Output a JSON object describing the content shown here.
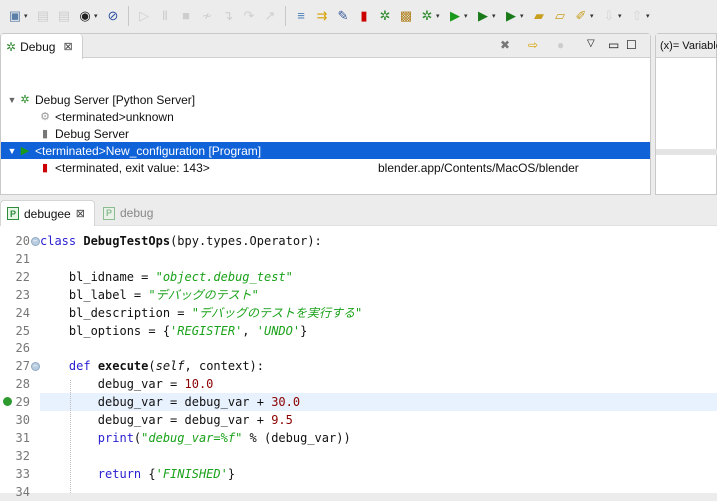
{
  "toolbar": {
    "icons": [
      "new-icon",
      "save-icon",
      "save-all-icon",
      "perspective-icon",
      "skip-breakpoints-icon",
      "resume-icon",
      "suspend-icon",
      "terminate-icon",
      "disconnect-icon",
      "step-into-icon",
      "step-over-icon",
      "step-return-icon",
      "drop-to-frame-icon",
      "use-step-filters-icon",
      "pydev-console-icon",
      "pydev-start-server-icon",
      "pydev-stop-server-icon",
      "pydev-open-icon",
      "debug-icon",
      "run-icon",
      "coverage-icon",
      "external-tools-icon",
      "open-type-icon",
      "open-folder-icon",
      "search-icon",
      "next-annotation-icon",
      "previous-annotation-icon"
    ]
  },
  "debug_view": {
    "tab_label": "Debug",
    "tree": [
      {
        "label": "Debug Server [Python Server]",
        "icon": "python-server-icon",
        "indent": 0,
        "expanded": true
      },
      {
        "label": "<terminated>unknown",
        "icon": "terminated-thread-icon",
        "indent": 1
      },
      {
        "label": "Debug Server",
        "icon": "debug-server-icon",
        "indent": 1
      },
      {
        "label": "<terminated>New_configuration [Program]",
        "icon": "launch-config-icon",
        "indent": 0,
        "expanded": true,
        "selected": true
      },
      {
        "label": "<terminated, exit value: 143>",
        "icon": "terminated-process-icon",
        "indent": 1,
        "path": "blender.app/Contents/MacOS/blender"
      }
    ]
  },
  "variables_view": {
    "tab_label": "(x)= Variables"
  },
  "editor": {
    "tabs": [
      {
        "label": "debugee",
        "active": true
      },
      {
        "label": "debug",
        "active": false
      }
    ],
    "current_line": 29,
    "lines": [
      {
        "n": "20",
        "fold": true,
        "t": [
          [
            "kw",
            "class "
          ],
          [
            "fn",
            "DebugTestOps"
          ],
          [
            "nm",
            "(bpy.types.Operator):"
          ]
        ]
      },
      {
        "n": "21",
        "t": []
      },
      {
        "n": "22",
        "t": [
          [
            "nm",
            "    bl_idname = "
          ],
          [
            "st",
            "\"object.debug_test\""
          ]
        ]
      },
      {
        "n": "23",
        "t": [
          [
            "nm",
            "    bl_label = "
          ],
          [
            "st",
            "\"デバッグのテスト\""
          ]
        ]
      },
      {
        "n": "24",
        "t": [
          [
            "nm",
            "    bl_description = "
          ],
          [
            "st",
            "\"デバッグのテストを実行する\""
          ]
        ]
      },
      {
        "n": "25",
        "t": [
          [
            "nm",
            "    bl_options = {"
          ],
          [
            "st",
            "'REGISTER'"
          ],
          [
            "nm",
            ", "
          ],
          [
            "st",
            "'UNDO'"
          ],
          [
            "nm",
            "}"
          ]
        ]
      },
      {
        "n": "26",
        "t": []
      },
      {
        "n": "27",
        "fold": true,
        "t": [
          [
            "nm",
            "    "
          ],
          [
            "kw",
            "def "
          ],
          [
            "fn",
            "execute"
          ],
          [
            "nm",
            "("
          ],
          [
            "it",
            "self"
          ],
          [
            "nm",
            ", context):"
          ]
        ]
      },
      {
        "n": "28",
        "t": [
          [
            "nm",
            "        debug_var = "
          ],
          [
            "nu",
            "10.0"
          ]
        ]
      },
      {
        "n": "29",
        "t": [
          [
            "nm",
            "        debug_var = debug_var + "
          ],
          [
            "nu",
            "30.0"
          ]
        ]
      },
      {
        "n": "30",
        "t": [
          [
            "nm",
            "        debug_var = debug_var + "
          ],
          [
            "nu",
            "9.5"
          ]
        ]
      },
      {
        "n": "31",
        "t": [
          [
            "nm",
            "        "
          ],
          [
            "kw",
            "print"
          ],
          [
            "nm",
            "("
          ],
          [
            "st",
            "\"debug_var=%f\""
          ],
          [
            "nm",
            " % (debug_var))"
          ]
        ]
      },
      {
        "n": "32",
        "t": []
      },
      {
        "n": "33",
        "t": [
          [
            "nm",
            "        "
          ],
          [
            "kw",
            "return "
          ],
          [
            "nm",
            "{"
          ],
          [
            "st",
            "'FINISHED'"
          ],
          [
            "nm",
            "}"
          ]
        ]
      },
      {
        "n": "34",
        "t": []
      }
    ]
  }
}
